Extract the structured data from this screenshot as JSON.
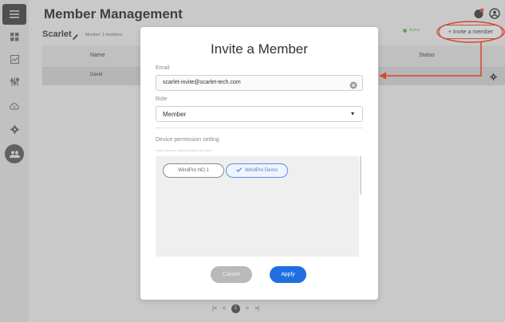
{
  "header": {
    "title": "Member Management"
  },
  "account": {
    "name": "Scarlet",
    "member_count": "Member: 1 members"
  },
  "toolbar": {
    "invite_label": "+ Invite a member"
  },
  "table": {
    "columns": [
      "Name",
      "Status"
    ],
    "rows": [
      {
        "name": "David",
        "status": "Active"
      }
    ]
  },
  "modal": {
    "title": "Invite a Member",
    "email_label": "Email",
    "email_value": "scarlet-invite@scarlet-tech.com",
    "role_label": "Role",
    "role_value": "Member",
    "permission_title": "Device permission setting",
    "permission_hint": "Select devices which member can view",
    "devices": [
      {
        "label": "WindPro NO.1",
        "selected": false
      },
      {
        "label": "WindPro Demo",
        "selected": true
      }
    ],
    "cancel_label": "Cancel",
    "apply_label": "Apply"
  },
  "pagination": {
    "first": "|<",
    "prev": "<",
    "current": "1",
    "next": ">",
    "last": ">|"
  },
  "colors": {
    "accent": "#1f6fe0",
    "annotation": "#d9452f",
    "status_active": "#5cb85c"
  },
  "icons": [
    "menu-icon",
    "dashboard-icon",
    "chart-icon",
    "settings-sliders-icon",
    "cloud-icon",
    "gear-icon",
    "members-icon",
    "notification-icon",
    "user-account-icon",
    "edit-icon",
    "clear-icon"
  ]
}
